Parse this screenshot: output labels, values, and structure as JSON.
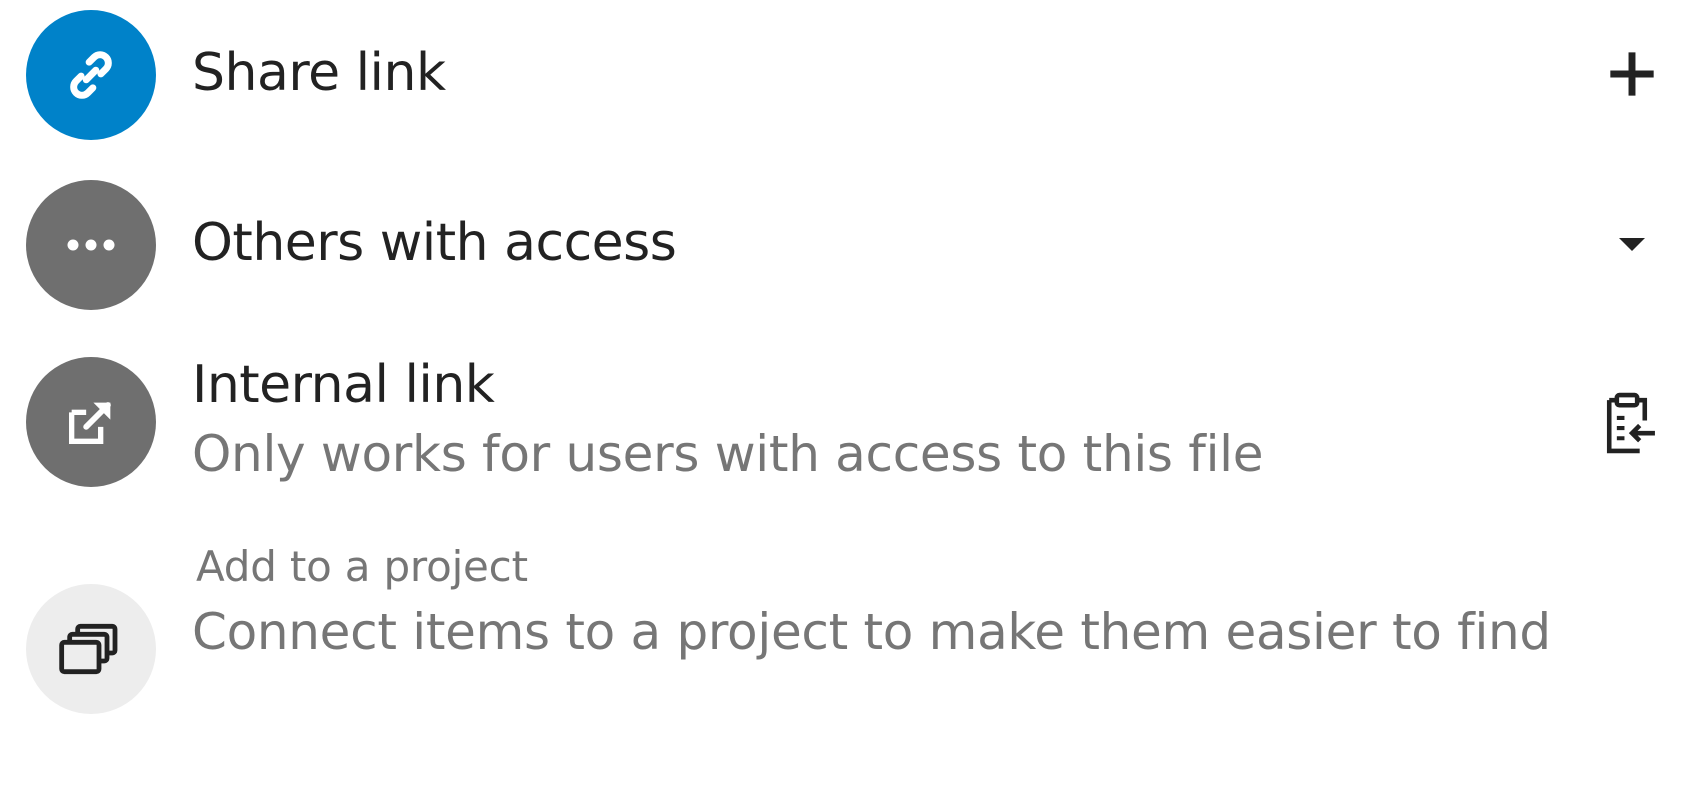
{
  "share_link": {
    "title": "Share link",
    "avatar_icon": "link-icon",
    "action_icon": "plus-icon",
    "color": "#0082c9"
  },
  "others_with_access": {
    "title": "Others with access",
    "avatar_icon": "more-horizontal-icon",
    "action_icon": "caret-down-icon",
    "color": "#6f6f6f"
  },
  "internal_link": {
    "title": "Internal link",
    "subtitle": "Only works for users with access to this file",
    "avatar_icon": "external-link-icon",
    "action_icon": "clipboard-copy-icon",
    "color": "#6f6f6f"
  },
  "add_to_project": {
    "title": "Add to a project",
    "subtitle": "Connect items to a project to make them easier to find",
    "avatar_icon": "projects-icon",
    "color": "#ededed"
  }
}
